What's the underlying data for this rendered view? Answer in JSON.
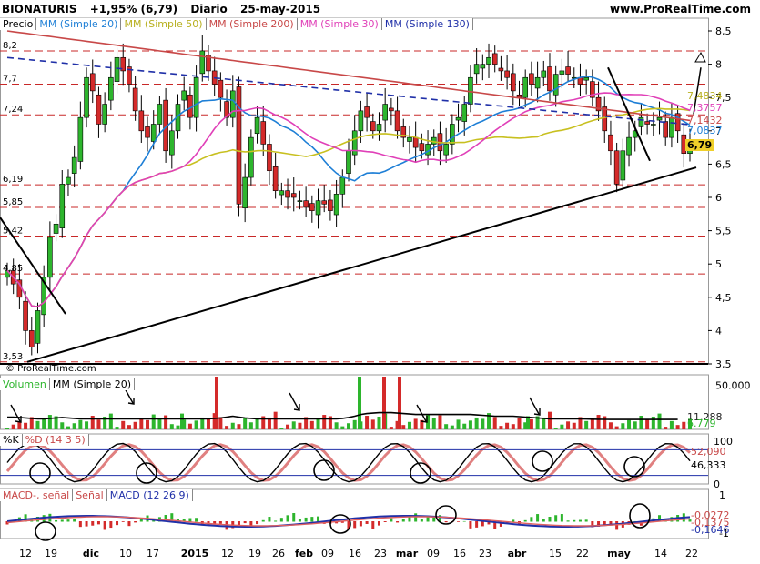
{
  "header": {
    "symbol": "BIONATURIS",
    "change": "+1,95% (6,79)",
    "period": "Diario",
    "date": "25-may-2015",
    "site": "www.ProRealTime.com"
  },
  "watermark": "© ProRealTime.com",
  "colors": {
    "up": "#2db52d",
    "down": "#d42a2a",
    "ma20": "#1e7fd6",
    "ma50": "#c8c020",
    "ma200": "#c84848",
    "ma30": "#e040b8",
    "ma130": "#2030a8"
  },
  "price_legend": [
    "Precio",
    "MM (Simple 20)",
    "MM (Simple 50)",
    "MM (Simple 200)",
    "MM (Simple 30)",
    "MM (Simple 130)"
  ],
  "price_axis": {
    "ticks": [
      "8,5",
      "8",
      "7,5",
      "7",
      "6,5",
      "6",
      "5,5",
      "5",
      "4,5",
      "4",
      "3,5"
    ],
    "ylim": [
      3.5,
      8.5
    ]
  },
  "price_levels": [
    "8,2",
    "7,7",
    "7,24",
    "6,19",
    "5,85",
    "5,42",
    "4,85",
    "3,53"
  ],
  "price_badges": {
    "ma50": "7,4834",
    "ma30": "7,3757",
    "ma200": "7,1432",
    "ma20": "7,0837",
    "last": "6,79"
  },
  "volume": {
    "legend": [
      "Volumen",
      "MM (Simple 20)"
    ],
    "ticks": [
      "50.000"
    ],
    "ma_badge": "11.288",
    "last_badge": "6.779"
  },
  "stoch": {
    "legend": [
      "%K",
      "%D (14 3 5)"
    ],
    "ticks": [
      "100",
      "0"
    ],
    "badges": [
      "52,090",
      "46,333"
    ]
  },
  "macd": {
    "legend": [
      "MACD-, señal",
      "Señal",
      "MACD (12 26 9)"
    ],
    "ticks": [
      "1",
      "-1"
    ],
    "badges": [
      "-0,0272",
      "-0,1375",
      "-0,1646"
    ]
  },
  "x_axis": [
    "12",
    "19",
    "dic",
    "10",
    "17",
    "2015",
    "12",
    "19",
    "26",
    "feb",
    "09",
    "16",
    "23",
    "mar",
    "09",
    "16",
    "23",
    "abr",
    "15",
    "22",
    "may",
    "14",
    "22"
  ],
  "chart_data": [
    {
      "type": "candlestick",
      "title": "BIONATURIS Diario",
      "ylim": [
        3.5,
        8.5
      ],
      "levels": [
        8.2,
        7.7,
        7.24,
        6.19,
        5.85,
        5.42,
        4.85,
        3.53
      ],
      "close": [
        4.9,
        4.7,
        4.5,
        4.0,
        3.75,
        4.3,
        4.8,
        5.4,
        5.6,
        6.2,
        6.3,
        6.6,
        7.2,
        7.8,
        7.6,
        7.1,
        7.4,
        7.8,
        8.1,
        7.9,
        7.7,
        7.3,
        7.0,
        6.9,
        7.1,
        7.4,
        6.7,
        7.0,
        7.4,
        7.6,
        7.2,
        7.8,
        8.2,
        7.9,
        7.7,
        7.5,
        7.2,
        7.6,
        5.9,
        6.3,
        6.9,
        7.2,
        6.8,
        6.4,
        6.1,
        6.1,
        6.0,
        6.0,
        5.95,
        5.85,
        5.8,
        5.95,
        5.9,
        5.8,
        6.05,
        6.3,
        6.7,
        7.0,
        7.3,
        7.2,
        7.0,
        7.1,
        7.4,
        7.3,
        7.0,
        6.9,
        6.9,
        6.75,
        6.7,
        6.8,
        6.9,
        6.7,
        6.8,
        7.1,
        7.2,
        7.4,
        7.8,
        8.0,
        8.0,
        8.1,
        8.0,
        7.9,
        7.8,
        7.6,
        7.5,
        7.8,
        7.7,
        7.8,
        7.9,
        7.6,
        7.85,
        7.9,
        7.85,
        7.8,
        7.7,
        7.8,
        7.5,
        7.3,
        7.0,
        6.7,
        6.2,
        6.7,
        6.9,
        7.0,
        7.2,
        7.1,
        7.1,
        7.2,
        6.9,
        7.2,
        7.0,
        6.66,
        6.79
      ],
      "volume_ma": [
        14000,
        14000,
        13500,
        13000,
        12500,
        12000,
        12000,
        12500,
        13000,
        13500,
        13000,
        12500,
        12000,
        12000,
        12000,
        12000,
        12000,
        12000,
        12000,
        12000,
        12000,
        12000,
        12000,
        12000,
        12000,
        12000,
        12000,
        12000,
        12000,
        12000,
        12000,
        12000,
        12000,
        12000,
        12500,
        13000,
        14000,
        15000,
        14000,
        13000,
        12500,
        12000,
        12000,
        12000,
        12000,
        12000,
        12000,
        12000,
        12000,
        12000,
        12000,
        12000,
        12000,
        12000,
        12000,
        12500,
        13500,
        15000,
        17000,
        18000,
        18500,
        19000,
        19000,
        19000,
        18500,
        18000,
        17500,
        17000,
        17000,
        17000,
        17000,
        17000,
        17000,
        17000,
        17000,
        17000,
        17000,
        16500,
        16000,
        15500,
        15000,
        15000,
        15000,
        15000,
        14500,
        14000,
        13500,
        13000,
        12500,
        12000,
        12000,
        12000,
        12000,
        12000,
        12000,
        11800,
        11600,
        11500,
        11400,
        11300,
        11300,
        11300,
        11300,
        11300,
        11300,
        11300,
        11300,
        11300,
        11300,
        11300,
        11288
      ]
    },
    {
      "type": "area",
      "title": "%K %D (14 3 5)",
      "ylim": [
        0,
        100
      ]
    },
    {
      "type": "bar",
      "title": "MACD (12 26 9)",
      "ylim": [
        -1,
        1
      ]
    }
  ]
}
